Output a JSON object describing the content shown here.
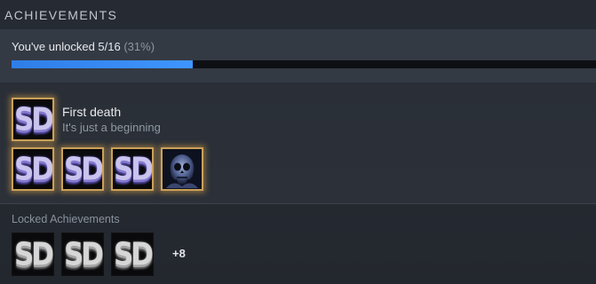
{
  "section": {
    "title": "ACHIEVEMENTS"
  },
  "progress": {
    "label": "You've unlocked 5/16",
    "percent_text": "(31%)",
    "fraction": 0.31
  },
  "featured": {
    "title": "First death",
    "description": "It's just a beginning",
    "badge_text": "SD"
  },
  "unlocked_badges": [
    {
      "text": "SD"
    },
    {
      "text": "SD"
    },
    {
      "text": "SD"
    },
    {
      "icon": "skull-icon"
    }
  ],
  "locked": {
    "title": "Locked Achievements",
    "badges": [
      {
        "text": "SD"
      },
      {
        "text": "SD"
      },
      {
        "text": "SD"
      }
    ],
    "more_label": "+8"
  },
  "colors": {
    "accent": "#3f95ff",
    "unlocked_glow": "#caa15a"
  }
}
